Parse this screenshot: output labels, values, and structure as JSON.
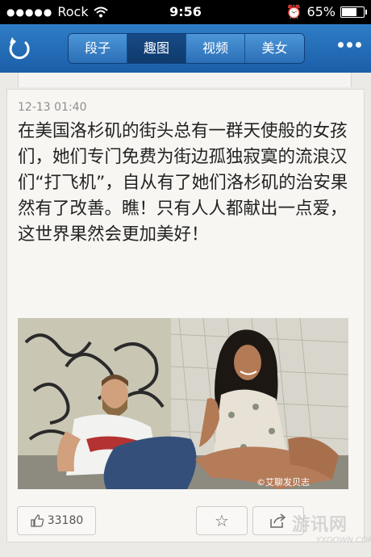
{
  "status_bar": {
    "carrier": "Rock",
    "time": "9:56",
    "battery": "65%"
  },
  "nav": {
    "tabs": [
      "段子",
      "趣图",
      "视频",
      "美女"
    ],
    "active_tab": "趣图"
  },
  "post": {
    "timestamp": "12-13 01:40",
    "text": "在美国洛杉矶的街头总有一群天使般的女孩们，她们专门免费为街边孤独寂寞的流浪汉们“打飞机”，自从有了她们洛杉矶的治安果然有了改善。瞧！只有人人都献出一点爱，这世界果然会更加美好！",
    "photo_watermark": "©艾聊发贝志",
    "like_count": "33180"
  },
  "watermark": {
    "main": "游讯网",
    "sub": "YXDOWN.COM"
  },
  "colors": {
    "nav_blue": "#1f68b2",
    "active_tab": "#123f75"
  }
}
